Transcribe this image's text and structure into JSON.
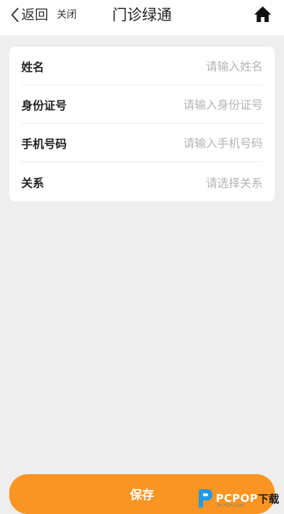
{
  "header": {
    "back_label": "返回",
    "close_label": "关闭",
    "title": "门诊绿通"
  },
  "form": {
    "fields": [
      {
        "label": "姓名",
        "placeholder": "请输入姓名",
        "value": ""
      },
      {
        "label": "身份证号",
        "placeholder": "请输入身份证号",
        "value": ""
      },
      {
        "label": "手机号码",
        "placeholder": "请输入手机号码",
        "value": ""
      },
      {
        "label": "关系",
        "placeholder": "请选择关系",
        "value": ""
      }
    ]
  },
  "footer": {
    "save_label": "保存"
  },
  "watermark": {
    "brand": "PCPOP",
    "suffix": "下载",
    "sub": "PCPOP.COM"
  },
  "colors": {
    "accent": "#fa9524",
    "background": "#eeeeee",
    "card": "#ffffff",
    "placeholder": "#b4b4b4"
  },
  "icons": {
    "back": "chevron-left-icon",
    "home": "home-icon",
    "watermark_logo": "p-logo-icon"
  }
}
